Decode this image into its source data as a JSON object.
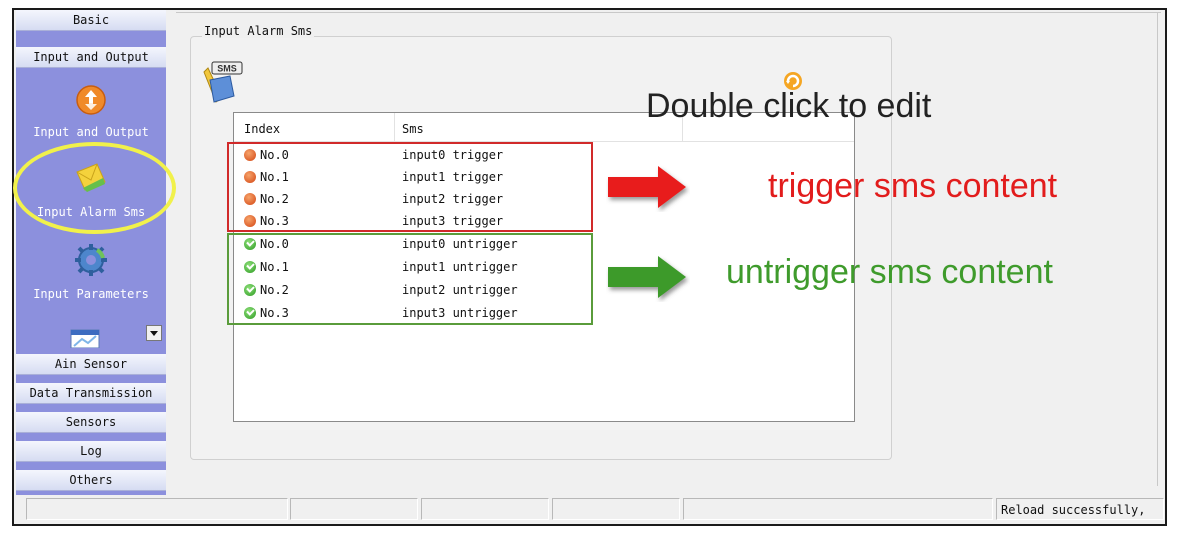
{
  "sidebar": {
    "top_buttons": [
      "Basic",
      "Input and Output"
    ],
    "items": [
      {
        "label": "Input and Output",
        "icon": "io-arrows-icon"
      },
      {
        "label": "Input Alarm Sms",
        "icon": "sms-envelope-icon"
      },
      {
        "label": "Input Parameters",
        "icon": "gear-icon"
      },
      {
        "label": "",
        "icon": "window-icon"
      }
    ],
    "bottom_buttons": [
      "Ain Sensor",
      "Data Transmission",
      "Sensors",
      "Log",
      "Others"
    ]
  },
  "panel": {
    "title": "Input Alarm Sms",
    "icon": "sms-icon",
    "columns": [
      "Index",
      "Sms"
    ],
    "rows": [
      {
        "index": "No.0",
        "sms": "input0 trigger",
        "state": "trigger"
      },
      {
        "index": "No.1",
        "sms": "input1 trigger",
        "state": "trigger"
      },
      {
        "index": "No.2",
        "sms": "input2 trigger",
        "state": "trigger"
      },
      {
        "index": "No.3",
        "sms": "input3 trigger",
        "state": "trigger"
      },
      {
        "index": "No.0",
        "sms": "input0 untrigger",
        "state": "untrigger"
      },
      {
        "index": "No.1",
        "sms": "input1 untrigger",
        "state": "untrigger"
      },
      {
        "index": "No.2",
        "sms": "input2 untrigger",
        "state": "untrigger"
      },
      {
        "index": "No.3",
        "sms": "input3 untrigger",
        "state": "untrigger"
      }
    ]
  },
  "annotations": {
    "edit_hint": "Double click to edit",
    "trigger_label": "trigger sms content",
    "untrigger_label": "untrigger sms content"
  },
  "statusbar": {
    "message": "Reload successfully,"
  },
  "colors": {
    "sidebar_bg": "#8c90dd",
    "trigger_red": "#e21c1c",
    "untrigger_green": "#3f9b2c",
    "highlight_yellow": "#f1f14b"
  }
}
